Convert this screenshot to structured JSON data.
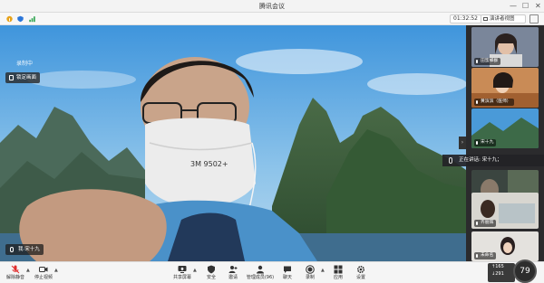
{
  "window": {
    "title": "腾讯会议"
  },
  "toolbar": {
    "timer": "01:32:52",
    "view_mode": "演讲者视图"
  },
  "stage": {
    "recording_label": "录制中",
    "lock_button": "锁定画面",
    "speaker_name_tag": "我·宋十九"
  },
  "participants": [
    {
      "label": "田蜜蜂群"
    },
    {
      "label": "黄滨滨（医师）"
    },
    {
      "label": "宋十九"
    },
    {
      "label": "朱梅2172-3079"
    },
    {
      "label": "齐丽辉"
    },
    {
      "label": "未命名"
    }
  ],
  "speaking_banner": "正在讲话: 宋十九；",
  "bottom_bar": {
    "mute": "解除静音",
    "video": "停止视频",
    "share": "共享屏幕",
    "security": "安全",
    "invite": "邀请",
    "members": "管理成员(96)",
    "chat": "聊天",
    "record": "录制",
    "apps": "应用",
    "settings": "设置"
  },
  "network": {
    "up": "165",
    "down": "291",
    "score": "79"
  },
  "colors": {
    "accent": "#1a73e8",
    "mute_red": "#e02d2d"
  }
}
